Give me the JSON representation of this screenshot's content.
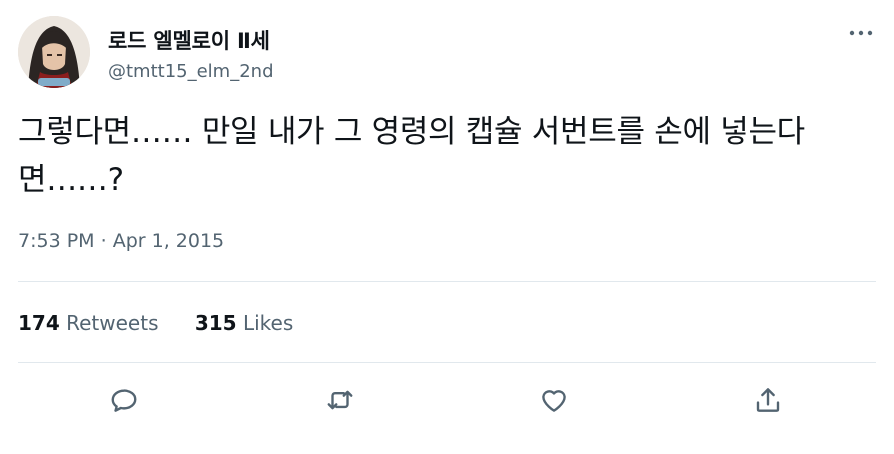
{
  "author": {
    "display_name": "로드 엘멜로이 Ⅱ세",
    "handle": "@tmtt15_elm_2nd"
  },
  "tweet": {
    "text": "그렇다면…… 만일 내가 그 영령의 캡슐 서번트를 손에 넣는다면……?",
    "time": "7:53 PM",
    "separator": "·",
    "date": "Apr 1, 2015"
  },
  "stats": {
    "retweets_count": "174",
    "retweets_label": "Retweets",
    "likes_count": "315",
    "likes_label": "Likes"
  },
  "icons": {
    "more": "more-horizontal-icon",
    "reply": "reply-icon",
    "retweet": "retweet-icon",
    "like": "heart-icon",
    "share": "share-icon"
  },
  "colors": {
    "text": "#0f1419",
    "secondary": "#536471",
    "divider": "#e1e8ed"
  }
}
